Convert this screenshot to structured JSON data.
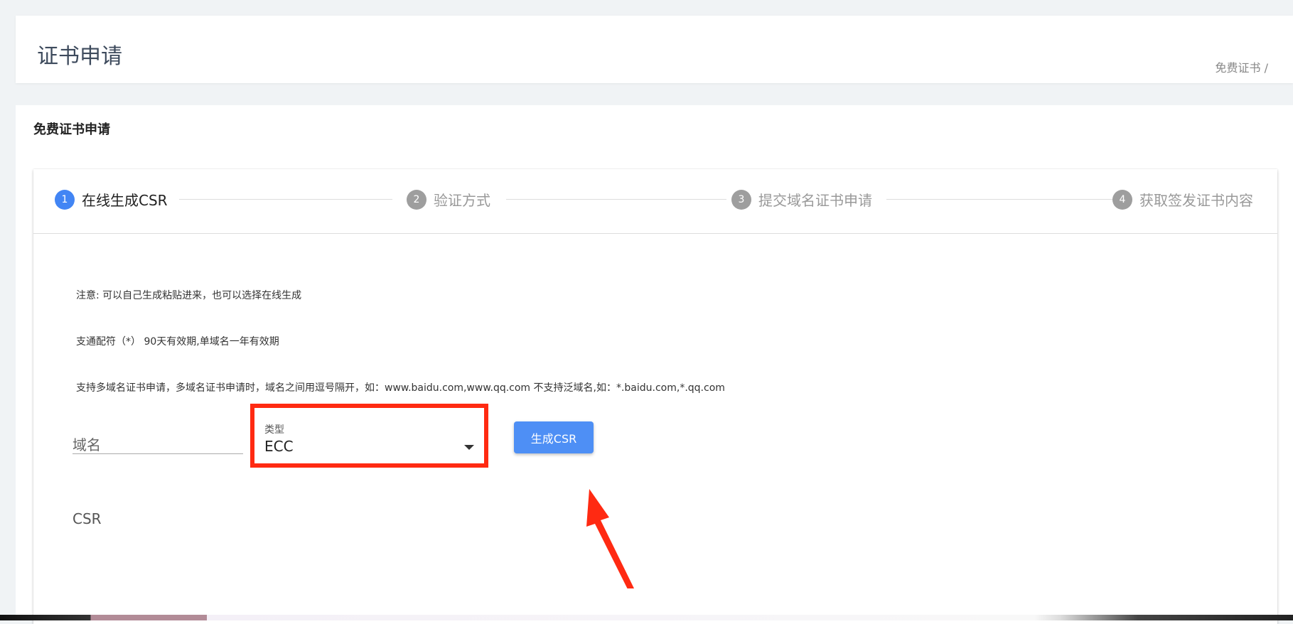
{
  "header": {
    "title": "证书申请",
    "breadcrumb": "免费证书 /"
  },
  "section": {
    "title": "免费证书申请"
  },
  "steps": [
    {
      "number": "1",
      "label": "在线生成CSR"
    },
    {
      "number": "2",
      "label": "验证方式"
    },
    {
      "number": "3",
      "label": "提交域名证书申请"
    },
    {
      "number": "4",
      "label": "获取签发证书内容"
    }
  ],
  "notes": [
    "注意: 可以自己生成粘贴进来，也可以选择在线生成",
    "支通配符（*） 90天有效期,单域名一年有效期",
    "支持多域名证书申请，多域名证书申请时，域名之间用逗号隔开，如：www.baidu.com,www.qq.com 不支持泛域名,如：*.baidu.com,*.qq.com"
  ],
  "form": {
    "domain_placeholder": "域名",
    "type_label": "类型",
    "type_value": "ECC",
    "generate_button": "生成CSR",
    "csr_label": "CSR"
  },
  "colors": {
    "accent": "#4285f4",
    "highlight": "#ff2a12"
  },
  "icons": {
    "dropdown": "chevron-down-icon",
    "annotation": "red-arrow"
  }
}
